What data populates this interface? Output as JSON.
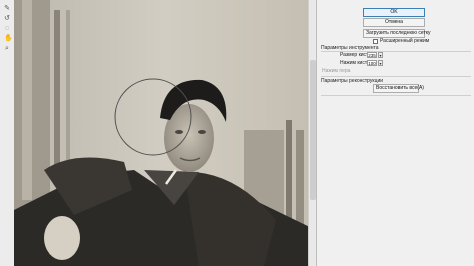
{
  "panel": {
    "ok_label": "OK",
    "cancel_label": "Отмена",
    "load_last_mesh_label": "Загрузить последнюю сетку",
    "advanced_mode_label": "Расширенный режим",
    "brush_settings_title": "Параметры инструмента",
    "brush_size_label": "Размер кисти:",
    "brush_size_value": "235",
    "brush_pressure_label": "Нажим кисти:",
    "brush_pressure_value": "100",
    "stylus_pressure_label": "Нажим пера",
    "reconstruct_title": "Параметры реконструкции",
    "restore_all_label": "Восстановить все(A)",
    "spin_down_glyph": "▾"
  },
  "colors": {
    "primary_button_border": "#3c7fb1",
    "panel_background": "#f0f0f0"
  },
  "icons": [
    "forward-warp-tool-icon",
    "reconstruct-tool-icon",
    "twirl-tool-icon",
    "hand-tool-icon",
    "zoom-tool-icon"
  ]
}
